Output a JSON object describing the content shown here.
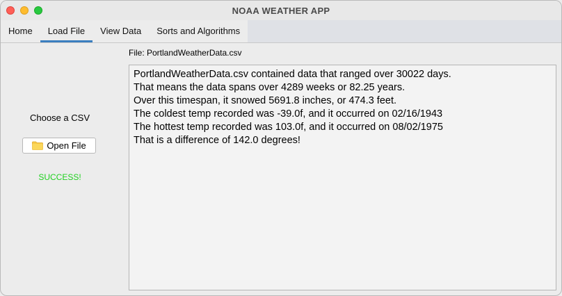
{
  "window": {
    "title": "NOAA WEATHER APP"
  },
  "tabs": [
    {
      "label": "Home"
    },
    {
      "label": "Load File"
    },
    {
      "label": "View Data"
    },
    {
      "label": "Sorts and Algorithms"
    }
  ],
  "active_tab": "Load File",
  "left": {
    "choose_label": "Choose a CSV",
    "open_button_label": "Open File",
    "open_button_icon": "folder-icon",
    "status_text": "SUCCESS!",
    "status_color": "#1fd11f"
  },
  "file_label": "File: PortlandWeatherData.csv",
  "output_lines": [
    "PortlandWeatherData.csv contained data that ranged over 30022 days.",
    "That means the data spans over 4289 weeks or 82.25 years.",
    "Over this timespan, it snowed 5691.8 inches, or 474.3 feet.",
    "The coldest temp recorded was -39.0f, and it occurred on 02/16/1943",
    "The hottest temp recorded was 103.0f, and it occurred on 08/02/1975",
    "That is a difference of 142.0 degrees!"
  ]
}
